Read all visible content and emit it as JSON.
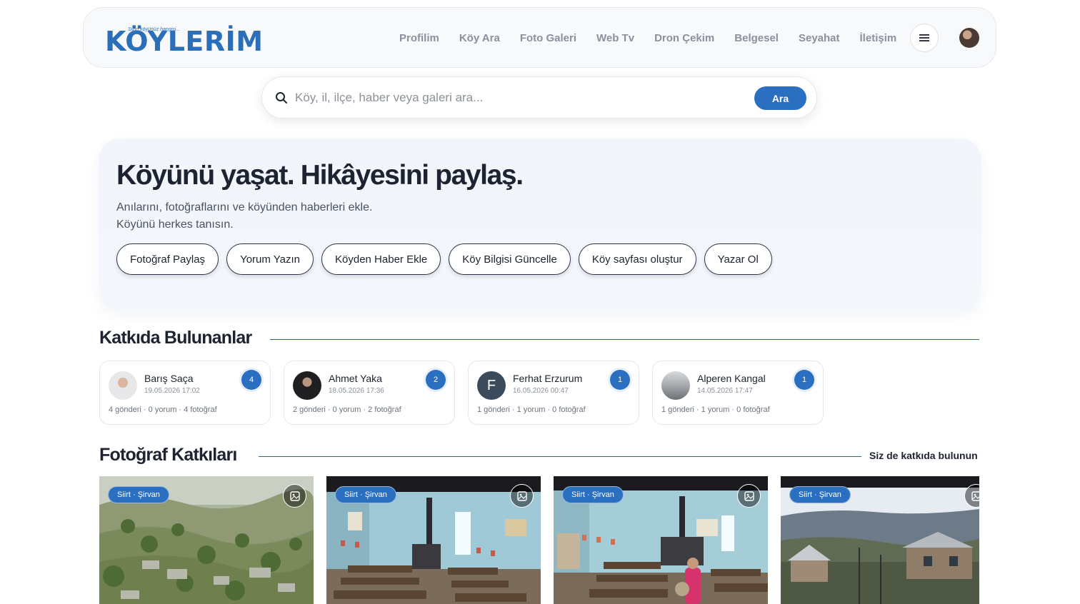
{
  "header": {
    "logo_tagline": "Sizin köyünüz hangisi...",
    "logo_text": "KÖYLERİM",
    "nav": [
      "Profilim",
      "Köy Ara",
      "Foto Galeri",
      "Web Tv",
      "Dron Çekim",
      "Belgesel",
      "Seyahat",
      "İletişim"
    ]
  },
  "search": {
    "placeholder": "Köy, il, ilçe, haber veya galeri ara...",
    "button": "Ara"
  },
  "hero": {
    "title": "Köyünü yaşat. Hikâyesini paylaş.",
    "subtitle_line1": "Anılarını, fotoğraflarını ve köyünden haberleri ekle.",
    "subtitle_line2": "Köyünü herkes tanısın.",
    "actions": [
      "Fotoğraf Paylaş",
      "Yorum Yazın",
      "Köyden Haber Ekle",
      "Köy Bilgisi Güncelle",
      "Köy sayfası oluştur",
      "Yazar Ol"
    ]
  },
  "contributors": {
    "title": "Katkıda Bulunanlar",
    "items": [
      {
        "name": "Barış Saça",
        "date": "19.05.2026 17:02",
        "count": "4",
        "stats": "4 gönderi · 0 yorum · 4 fotoğraf",
        "initial": ""
      },
      {
        "name": "Ahmet Yaka",
        "date": "18.05.2026 17:36",
        "count": "2",
        "stats": "2 gönderi · 0 yorum · 2 fotoğraf",
        "initial": ""
      },
      {
        "name": "Ferhat Erzurum",
        "date": "16.05.2026 00:47",
        "count": "1",
        "stats": "1 gönderi · 1 yorum · 0 fotoğraf",
        "initial": "F"
      },
      {
        "name": "Alperen Kangal",
        "date": "14.05.2026 17:47",
        "count": "1",
        "stats": "1 gönderi · 1 yorum · 0 fotoğraf",
        "initial": ""
      }
    ]
  },
  "photos": {
    "title": "Fotoğraf Katkıları",
    "link": "Siz de katkıda bulunun",
    "items": [
      {
        "tag": "Siirt · Şirvan"
      },
      {
        "tag": "Siirt · Şirvan"
      },
      {
        "tag": "Siirt · Şirvan"
      },
      {
        "tag": "Siirt · Şirvan"
      }
    ]
  },
  "colors": {
    "accent": "#2b6fc0",
    "text": "#1d2330",
    "muted": "#8a919e"
  }
}
